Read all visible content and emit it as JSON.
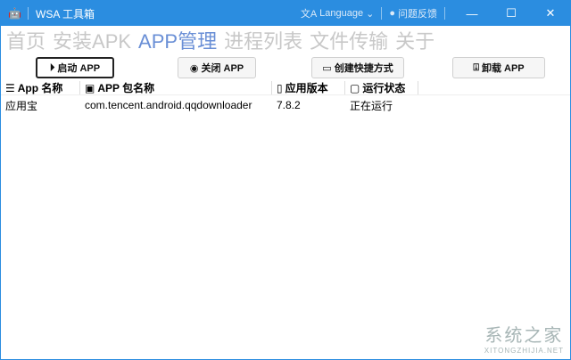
{
  "window": {
    "title": "WSA 工具箱",
    "language": "Language",
    "feedback": "问题反馈",
    "minimize": "—",
    "maximize": "☐",
    "close": "✕"
  },
  "nav": [
    "首页",
    "安装APK",
    "APP管理",
    "进程列表",
    "文件传输",
    "关于"
  ],
  "toolbar": {
    "start": "启动 APP",
    "stop": "关闭 APP",
    "shortcut": "创建快捷方式",
    "uninstall": "卸载 APP"
  },
  "table": {
    "headers": [
      "App 名称",
      "APP 包名称",
      "应用版本",
      "运行状态"
    ],
    "rows": [
      [
        "应用宝",
        "com.tencent.android.qqdownloader",
        "7.8.2",
        "正在运行"
      ]
    ]
  },
  "watermark": {
    "cn": "系统之家",
    "en": "XITONGZHIJIA.NET"
  }
}
